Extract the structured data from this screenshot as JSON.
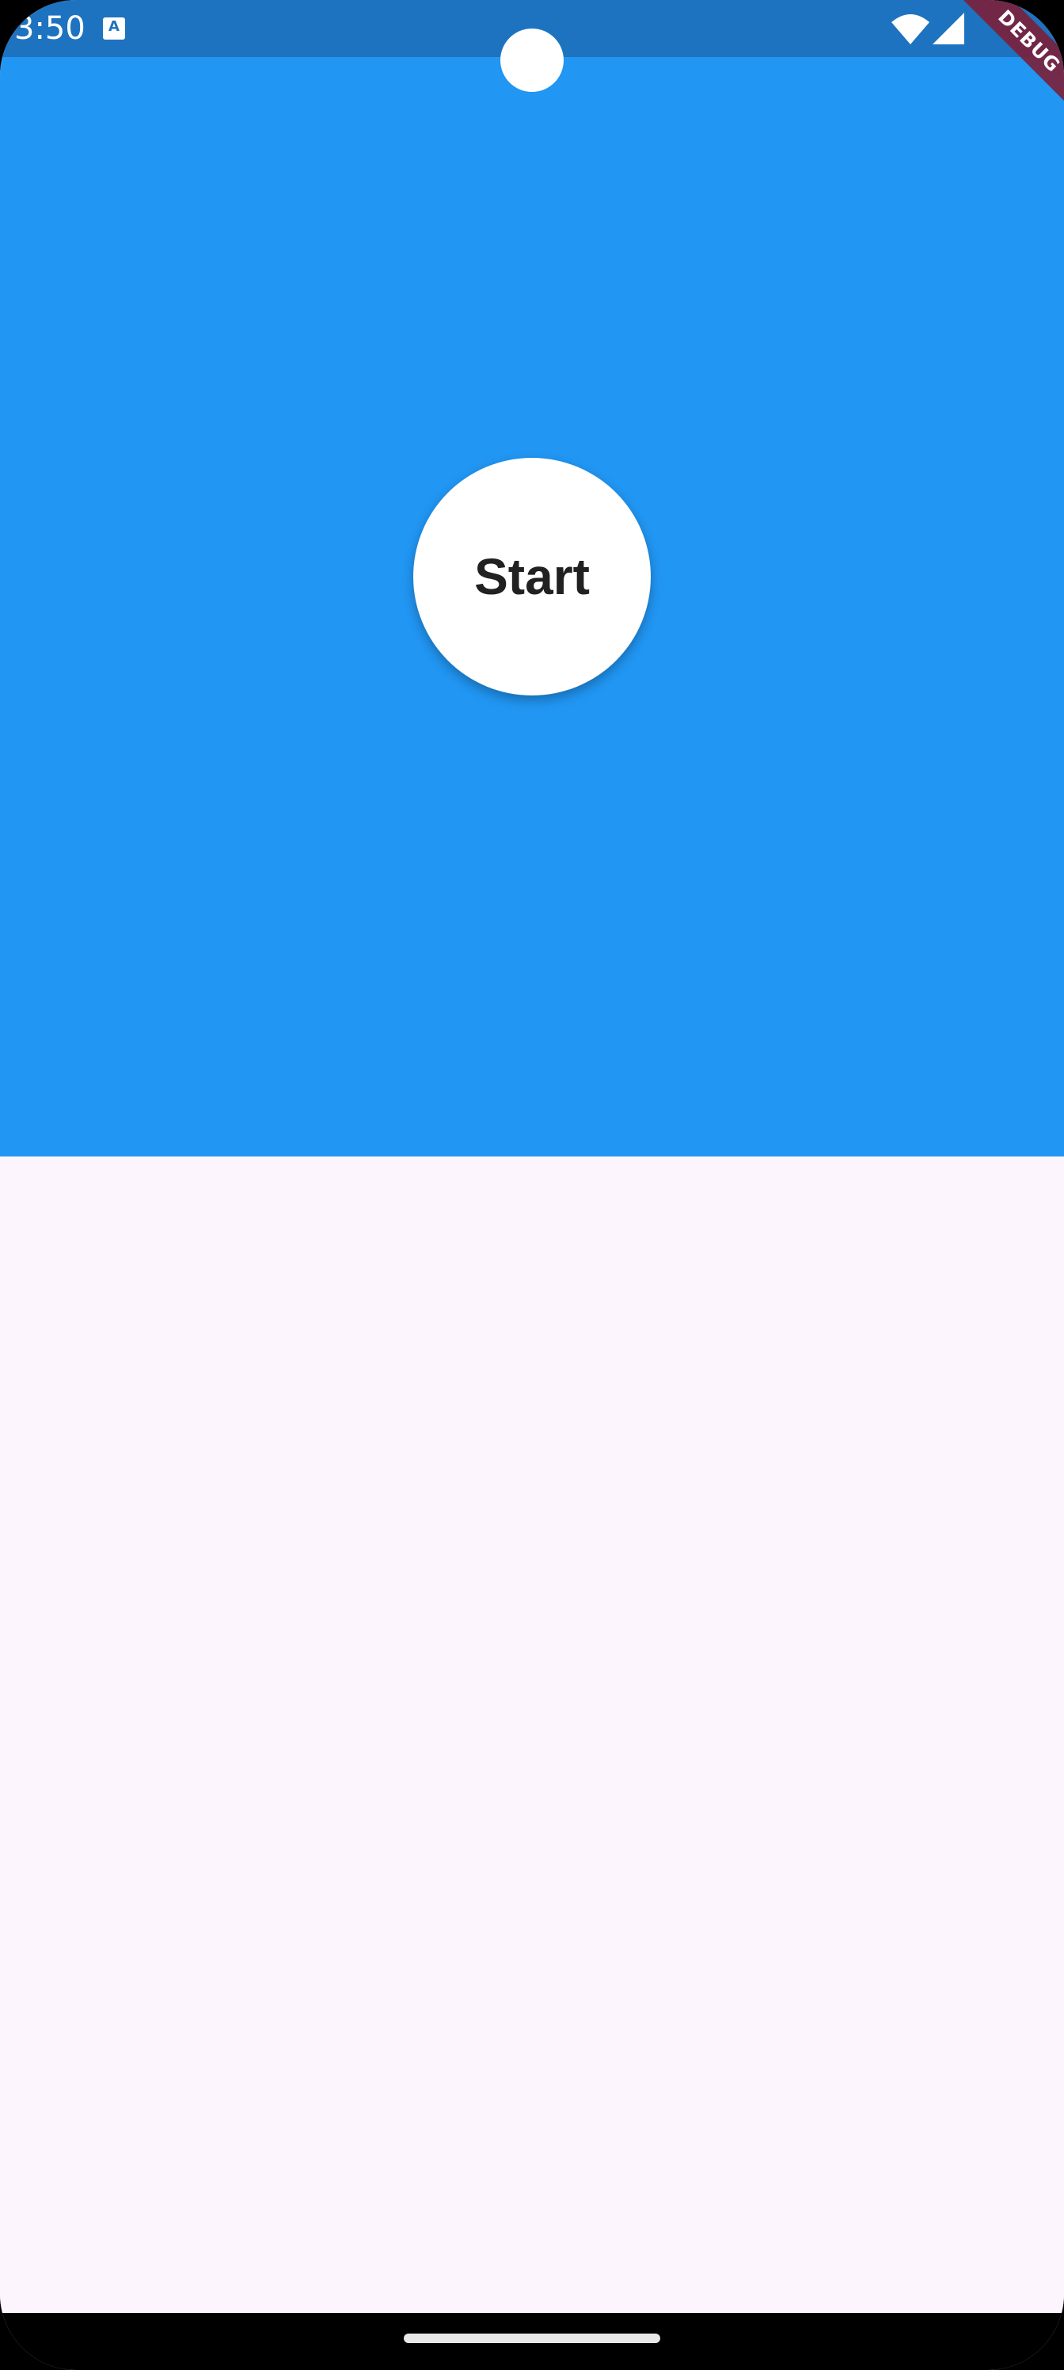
{
  "status_bar": {
    "time": "3:50",
    "app_icon_letter": "A"
  },
  "main": {
    "start_button_label": "Start"
  },
  "debug_banner": {
    "label": "DEBUG"
  },
  "colors": {
    "status_bar": "#1d73bf",
    "primary_panel": "#2196f3",
    "background": "#fcf5fd",
    "button": "#ffffff",
    "button_text": "#212121",
    "debug_banner": "#7c1f3a"
  }
}
